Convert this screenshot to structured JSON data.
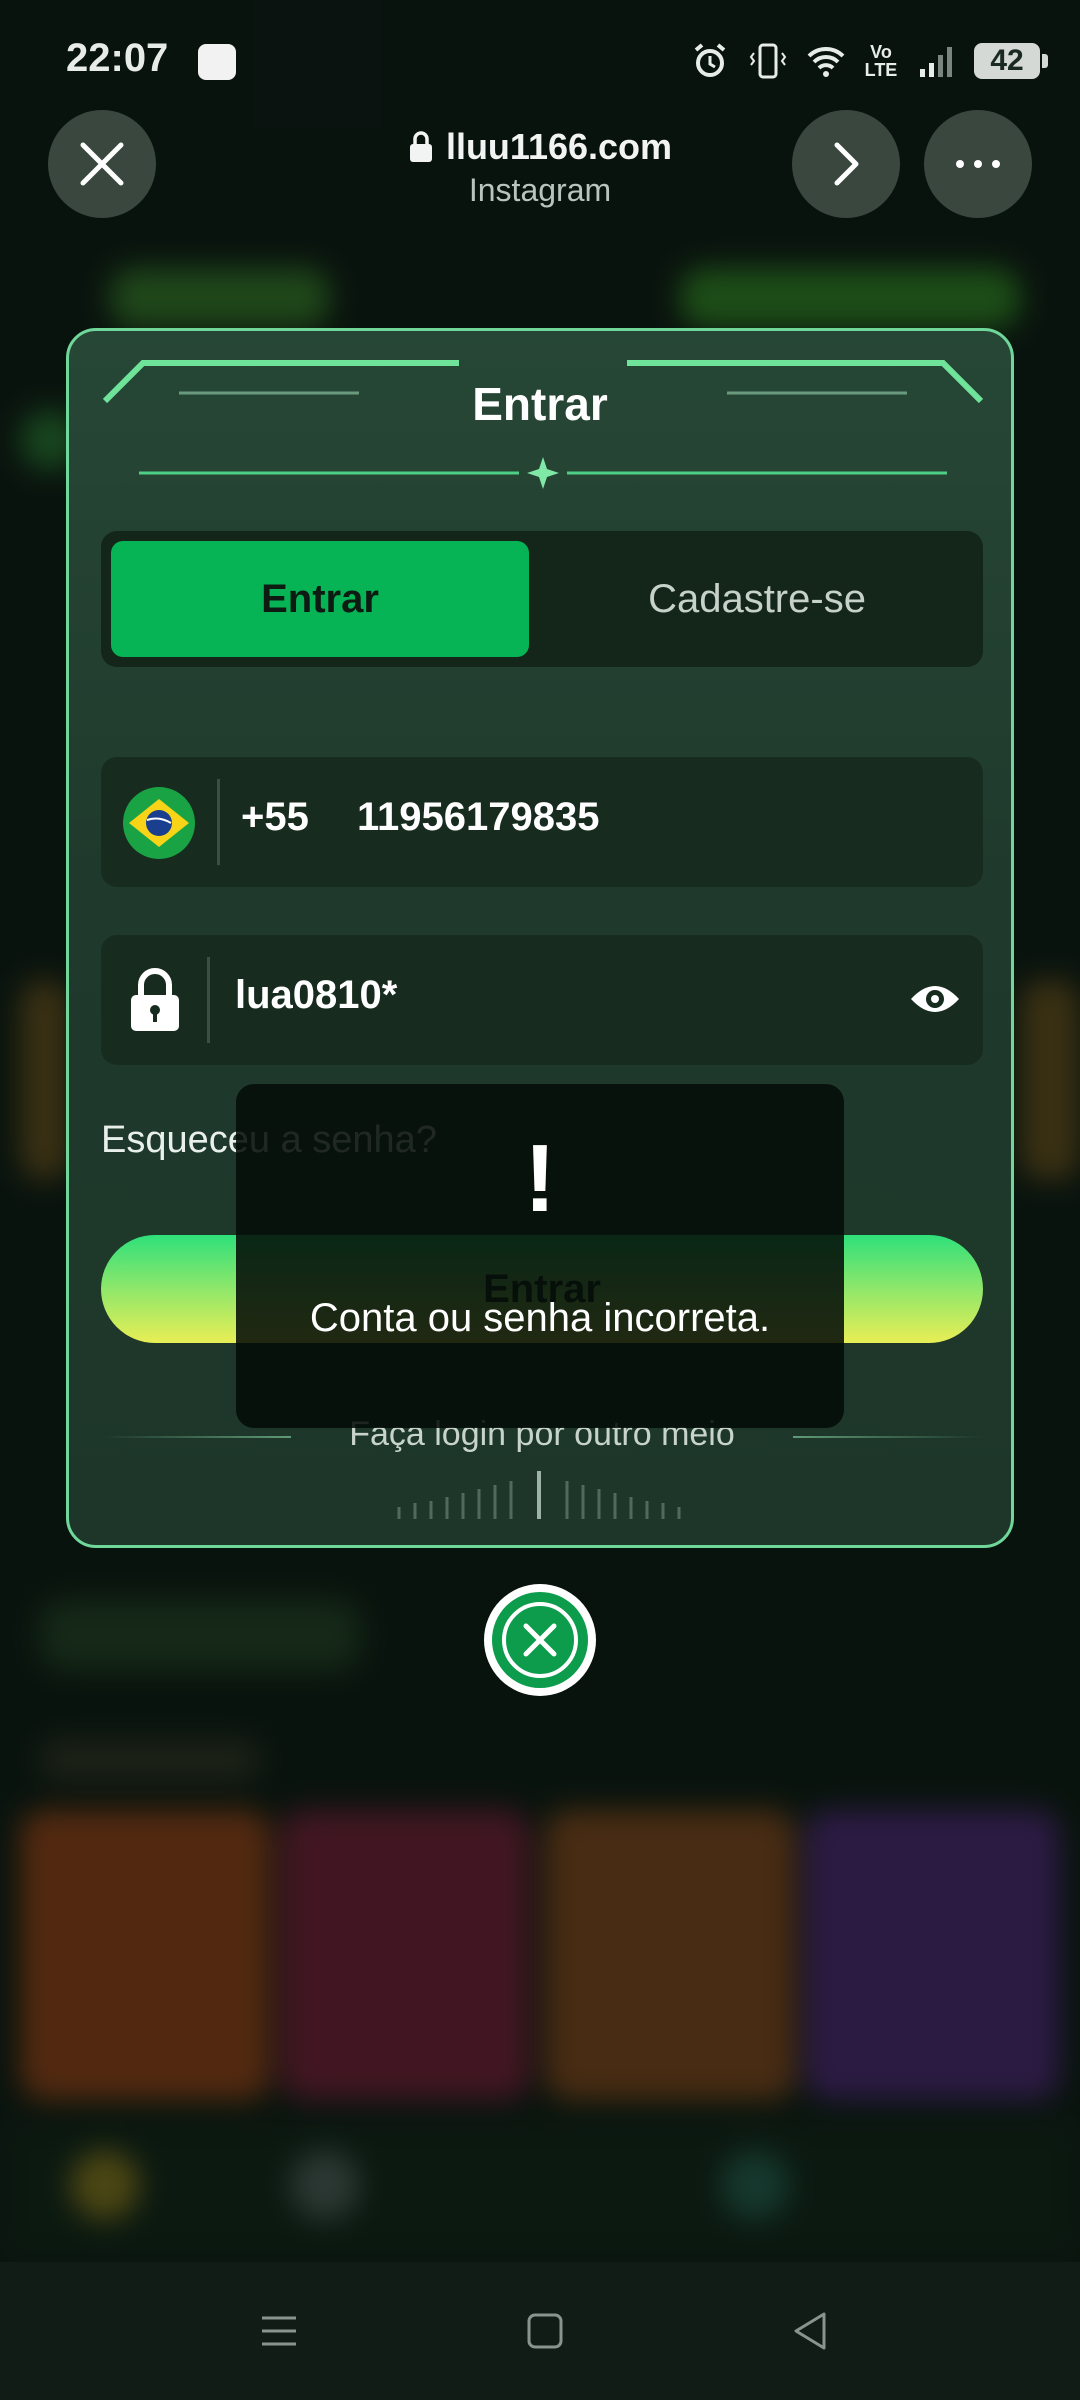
{
  "status_bar": {
    "time": "22:07",
    "volte": "Vo LTE",
    "battery": "42"
  },
  "browser": {
    "url": "lluu1166.com",
    "source": "Instagram"
  },
  "login": {
    "title": "Entrar",
    "tab_login": "Entrar",
    "tab_register": "Cadastre-se",
    "country_code": "+55",
    "phone": "11956179835",
    "password": "lua0810*",
    "forgot": "Esqueceu a senha?",
    "submit": "Entrar",
    "other_methods": "Faça login por outro meio"
  },
  "toast": {
    "icon": "!",
    "message": "Conta ou senha incorreta."
  },
  "colors": {
    "accent": "#06b455",
    "border": "#6fd79a"
  }
}
